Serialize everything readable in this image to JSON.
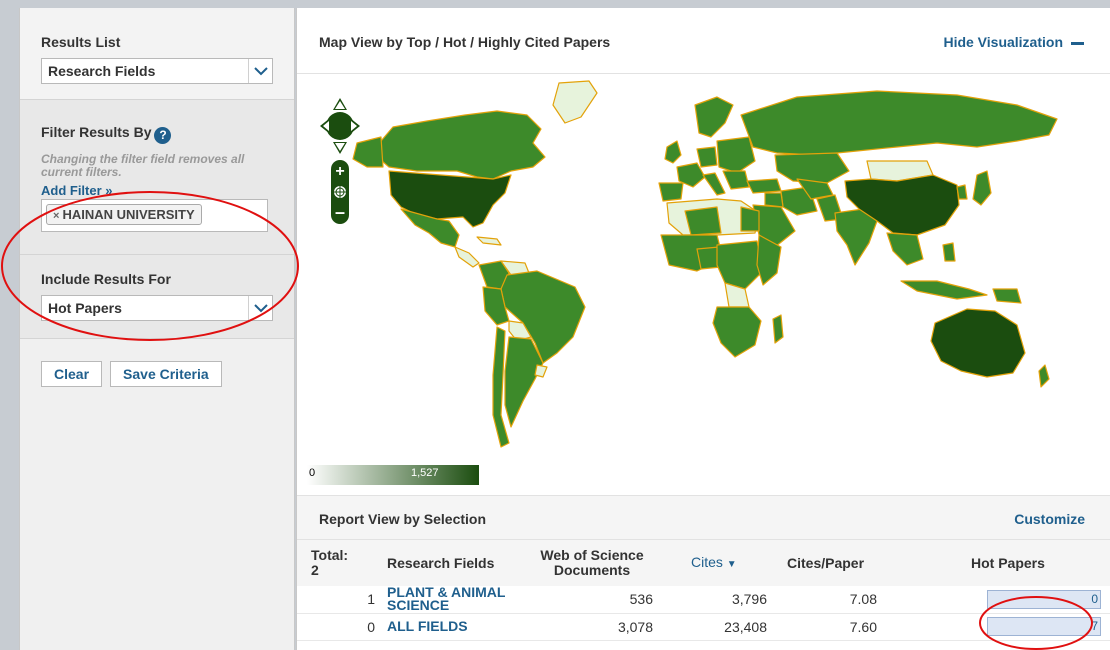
{
  "sidebar": {
    "results_list": {
      "heading": "Results List",
      "selected": "Research Fields"
    },
    "filter": {
      "heading": "Filter Results By",
      "help": "?",
      "note": "Changing the filter field removes all current filters.",
      "add_filter": "Add Filter »",
      "chip_remove": "×",
      "chip_label": "HAINAN UNIVERSITY"
    },
    "include": {
      "heading": "Include Results For",
      "selected": "Hot Papers"
    },
    "buttons": {
      "clear": "Clear",
      "save": "Save Criteria"
    }
  },
  "map": {
    "title": "Map View by Top / Hot / Highly Cited Papers",
    "hide_label": "Hide Visualization",
    "legend_min": "0",
    "legend_max": "1,527",
    "colors": {
      "land_dark": "#1b4d0f",
      "land_mid": "#3d8a2a",
      "land_light": "#e7f3dc",
      "border": "#e3a20a"
    }
  },
  "report": {
    "title": "Report View by Selection",
    "customize": "Customize",
    "columns": {
      "total": "Total:",
      "total_count": "2",
      "field": "Research Fields",
      "docs": "Web of Science Documents",
      "cites": "Cites",
      "cites_per_paper": "Cites/Paper",
      "hot": "Hot Papers"
    },
    "rows": [
      {
        "rank": "1",
        "field": "PLANT & ANIMAL SCIENCE",
        "docs": "536",
        "cites": "3,796",
        "cpp": "7.08",
        "hot": "0"
      },
      {
        "rank": "0",
        "field": "ALL FIELDS",
        "docs": "3,078",
        "cites": "23,408",
        "cpp": "7.60",
        "hot": "7"
      }
    ]
  },
  "colors": {
    "accent": "#1f5f8d",
    "annotation": "#e01010"
  }
}
